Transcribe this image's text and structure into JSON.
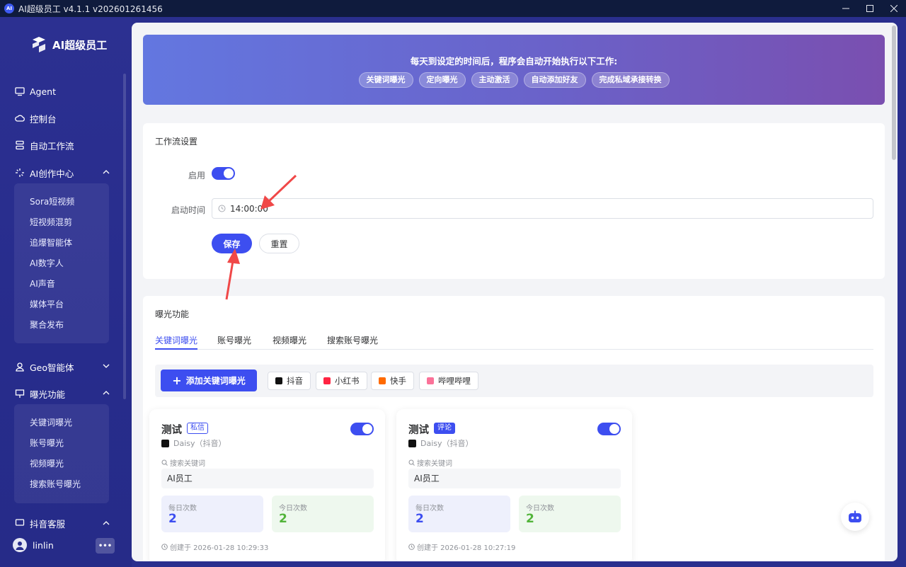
{
  "window": {
    "title": "AI超级员工 v4.1.1 v202601261456",
    "logo_text": "AI"
  },
  "sidebar": {
    "brand": "AI超级员工",
    "items": [
      {
        "label": "Agent",
        "icon": "monitor-icon"
      },
      {
        "label": "控制台",
        "icon": "cloud-icon"
      },
      {
        "label": "自动工作流",
        "icon": "workflow-icon"
      },
      {
        "label": "AI创作中心",
        "icon": "sparkle-icon",
        "expanded": true,
        "children": [
          "Sora短视频",
          "短视频混剪",
          "追爆智能体",
          "AI数字人",
          "AI声音",
          "媒体平台",
          "聚合发布"
        ]
      },
      {
        "label": "Geo智能体",
        "icon": "user-icon",
        "expanded": false
      },
      {
        "label": "曝光功能",
        "icon": "presentation-icon",
        "expanded": true,
        "children": [
          "关键词曝光",
          "账号曝光",
          "视频曝光",
          "搜索账号曝光"
        ]
      },
      {
        "label": "抖音客服",
        "icon": "chat-icon",
        "expanded": true
      }
    ],
    "user": {
      "name": "linlin",
      "more_label": "•••"
    }
  },
  "banner": {
    "title": "每天到设定的时间后，程序会自动开始执行以下工作:",
    "tags": [
      "关键词曝光",
      "定向曝光",
      "主动激活",
      "自动添加好友",
      "完成私域承接转换"
    ]
  },
  "workflow": {
    "title": "工作流设置",
    "enable_label": "启用",
    "enabled": true,
    "start_time_label": "启动时间",
    "start_time": "14:00:00",
    "save_label": "保存",
    "reset_label": "重置"
  },
  "exposure": {
    "title": "曝光功能",
    "tabs": [
      "关键词曝光",
      "账号曝光",
      "视频曝光",
      "搜索账号曝光"
    ],
    "active_tab": 0,
    "add_label": "添加关键词曝光",
    "platforms": [
      {
        "label": "抖音",
        "color": "#111111"
      },
      {
        "label": "小红书",
        "color": "#ff2442"
      },
      {
        "label": "快手",
        "color": "#ff6a00"
      },
      {
        "label": "哔哩哔哩",
        "color": "#fb7299"
      }
    ],
    "cards": [
      {
        "name": "测试",
        "badge": "私信",
        "account": "Daisy（抖音）",
        "search_label": "搜索关键词",
        "keyword": "AI员工",
        "daily_label": "每日次数",
        "daily": "2",
        "today_label": "今日次数",
        "today": "2",
        "created": "创建于 2026-01-28 10:29:33",
        "enabled": true
      },
      {
        "name": "测试",
        "badge": "评论",
        "account": "Daisy（抖音）",
        "search_label": "搜索关键词",
        "keyword": "AI员工",
        "daily_label": "每日次数",
        "daily": "2",
        "today_label": "今日次数",
        "today": "2",
        "created": "创建于 2026-01-28 10:27:19",
        "enabled": true
      }
    ]
  },
  "colors": {
    "primary": "#3d4ef0",
    "sidebar": "#2a2f8e",
    "annotation_arrow": "#f04848"
  }
}
